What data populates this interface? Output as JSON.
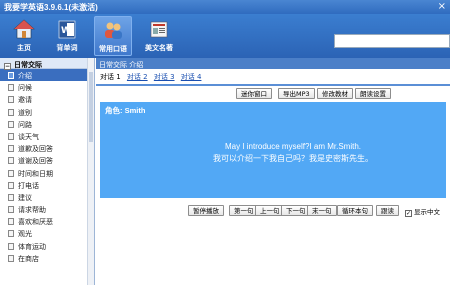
{
  "window": {
    "title": "我要学英语3.9.6.1(未激活)",
    "close": "×"
  },
  "toolbar": {
    "items": [
      {
        "label": "主页",
        "icon": "home-icon"
      },
      {
        "label": "背单词",
        "icon": "word-book-icon"
      },
      {
        "label": "常用口语",
        "icon": "users-icon",
        "active": true
      },
      {
        "label": "美文名著",
        "icon": "newspaper-icon"
      }
    ]
  },
  "sidebar": {
    "header": "日常交际",
    "items": [
      "介绍",
      "问候",
      "邀请",
      "道别",
      "问路",
      "谈天气",
      "道歉及回答",
      "道谢及回答",
      "时间和日期",
      "打电话",
      "建议",
      "请求帮助",
      "喜欢和厌恶",
      "观光",
      "体育运动",
      "在商店"
    ],
    "selected_index": 0
  },
  "main": {
    "breadcrumb": "日常交际 介绍",
    "dialog_tabs": [
      "对话 1",
      "对话 2",
      "对话 3",
      "对话 4"
    ],
    "top_buttons": [
      "迷你窗口",
      "导出MP3",
      "修改教材",
      "朗读设置"
    ],
    "role": "角色: Smith",
    "english_line": "May I introduce myself?I am Mr.Smith.",
    "chinese_line": "我可以介绍一下我自己吗？我是史密斯先生。",
    "bottom_buttons": [
      "暂停播放",
      "第一句",
      "上一句",
      "下一句",
      "末一句",
      "循环本句",
      "跟读"
    ],
    "show_chinese_label": "显示中文",
    "show_chinese_checked": true
  },
  "colors": {
    "accent": "#2f6bbf",
    "content_bg": "#52a8f5",
    "selected": "#3a6ebf"
  }
}
